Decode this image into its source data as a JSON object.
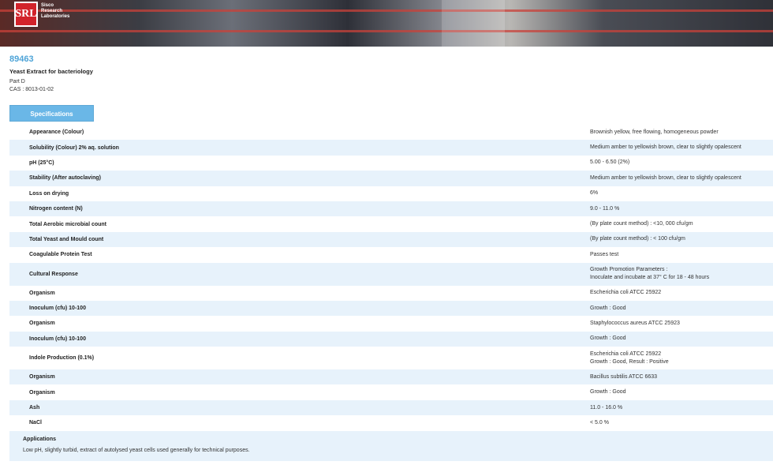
{
  "brand": {
    "logo_mark": "SRL",
    "name_lines": [
      "Sisco",
      "Research",
      "Laboratories"
    ]
  },
  "product": {
    "code": "89463",
    "name": "Yeast Extract for bacteriology",
    "part": "Part D",
    "cas": "CAS : 8013-01-02"
  },
  "tab": {
    "label": "Specifications"
  },
  "specs": [
    {
      "property": "Appearance (Colour)",
      "value": [
        "Brownish yellow, free flowing, homogeneous powder"
      ]
    },
    {
      "property": "Solubility (Colour) 2% aq. solution",
      "value": [
        "Medium amber to yellowish brown, clear to slightly opalescent"
      ]
    },
    {
      "property": "pH (25°C)",
      "value": [
        "5.00 - 6.50 (2%)"
      ]
    },
    {
      "property": "Stability (After autoclaving)",
      "value": [
        "Medium amber to yellowish brown, clear to slightly opalescent"
      ]
    },
    {
      "property": "Loss on drying",
      "value": [
        "6%"
      ]
    },
    {
      "property": "Nitrogen content (N)",
      "value": [
        "9.0 - 11.0 %"
      ]
    },
    {
      "property": "Total Aerobic microbial count",
      "value": [
        "(By plate count method) : <10, 000 cfu/gm"
      ]
    },
    {
      "property": "Total Yeast and Mould count",
      "value": [
        "(By plate count method) : < 100 cfu/gm"
      ]
    },
    {
      "property": "Coagulable Protein Test",
      "value": [
        "Passes test"
      ]
    },
    {
      "property": "Cultural Response",
      "value": [
        "Growth Promotion Parameters :",
        "Inoculate and incubate at 37° C for 18 - 48 hours"
      ]
    },
    {
      "property": "Organism",
      "value": [
        "Escherichia coli ATCC 25922"
      ]
    },
    {
      "property": "Inoculum (cfu) 10-100",
      "value": [
        "Growth : Good"
      ]
    },
    {
      "property": "Organism",
      "value": [
        "Staphylococcus aureus ATCC 25923"
      ]
    },
    {
      "property": "Inoculum (cfu) 10-100",
      "value": [
        "Growth : Good"
      ]
    },
    {
      "property": "Indole Production (0.1%)",
      "value": [
        "Escherichia coli ATCC 25922",
        "Growth : Good, Result : Positive"
      ]
    },
    {
      "property": "Organism",
      "value": [
        "Bacillus subtilis ATCC 6633"
      ]
    },
    {
      "property": "Organism",
      "value": [
        "Growth : Good"
      ]
    },
    {
      "property": "Ash",
      "value": [
        "11.0 - 16.0 %"
      ]
    },
    {
      "property": "NaCl",
      "value": [
        "< 5.0 %"
      ]
    }
  ],
  "applications": {
    "title": "Applications",
    "text": "Low pH, slightly turbid, extract of autolysed yeast cells used generally for technical purposes."
  },
  "colors": {
    "accent": "#4ea4d8",
    "tab_bg": "#6ab7e7",
    "row_alt": "#e7f2fb",
    "logo_red": "#d2232a"
  }
}
